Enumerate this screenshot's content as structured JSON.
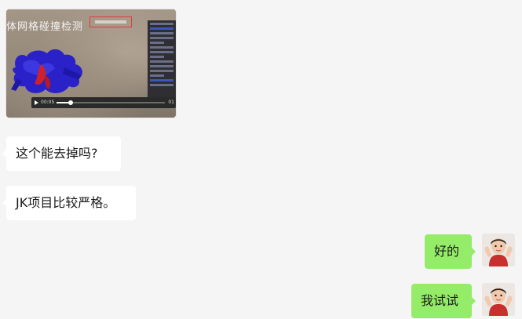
{
  "video": {
    "overlay_title": "体网格碰撞检测",
    "time_current": "00:05",
    "time_end": "01",
    "progress": 0.13
  },
  "messages": [
    {
      "side": "left",
      "text": "这个能去掉吗?"
    },
    {
      "side": "left",
      "text": "JK项目比较严格。"
    },
    {
      "side": "right",
      "text": "好的"
    },
    {
      "side": "right",
      "text": "我试试"
    }
  ],
  "colors": {
    "background": "#f5f5f5",
    "received_bubble": "#ffffff",
    "sent_bubble": "#95ec69",
    "highlight_box": "#e23b3b"
  }
}
